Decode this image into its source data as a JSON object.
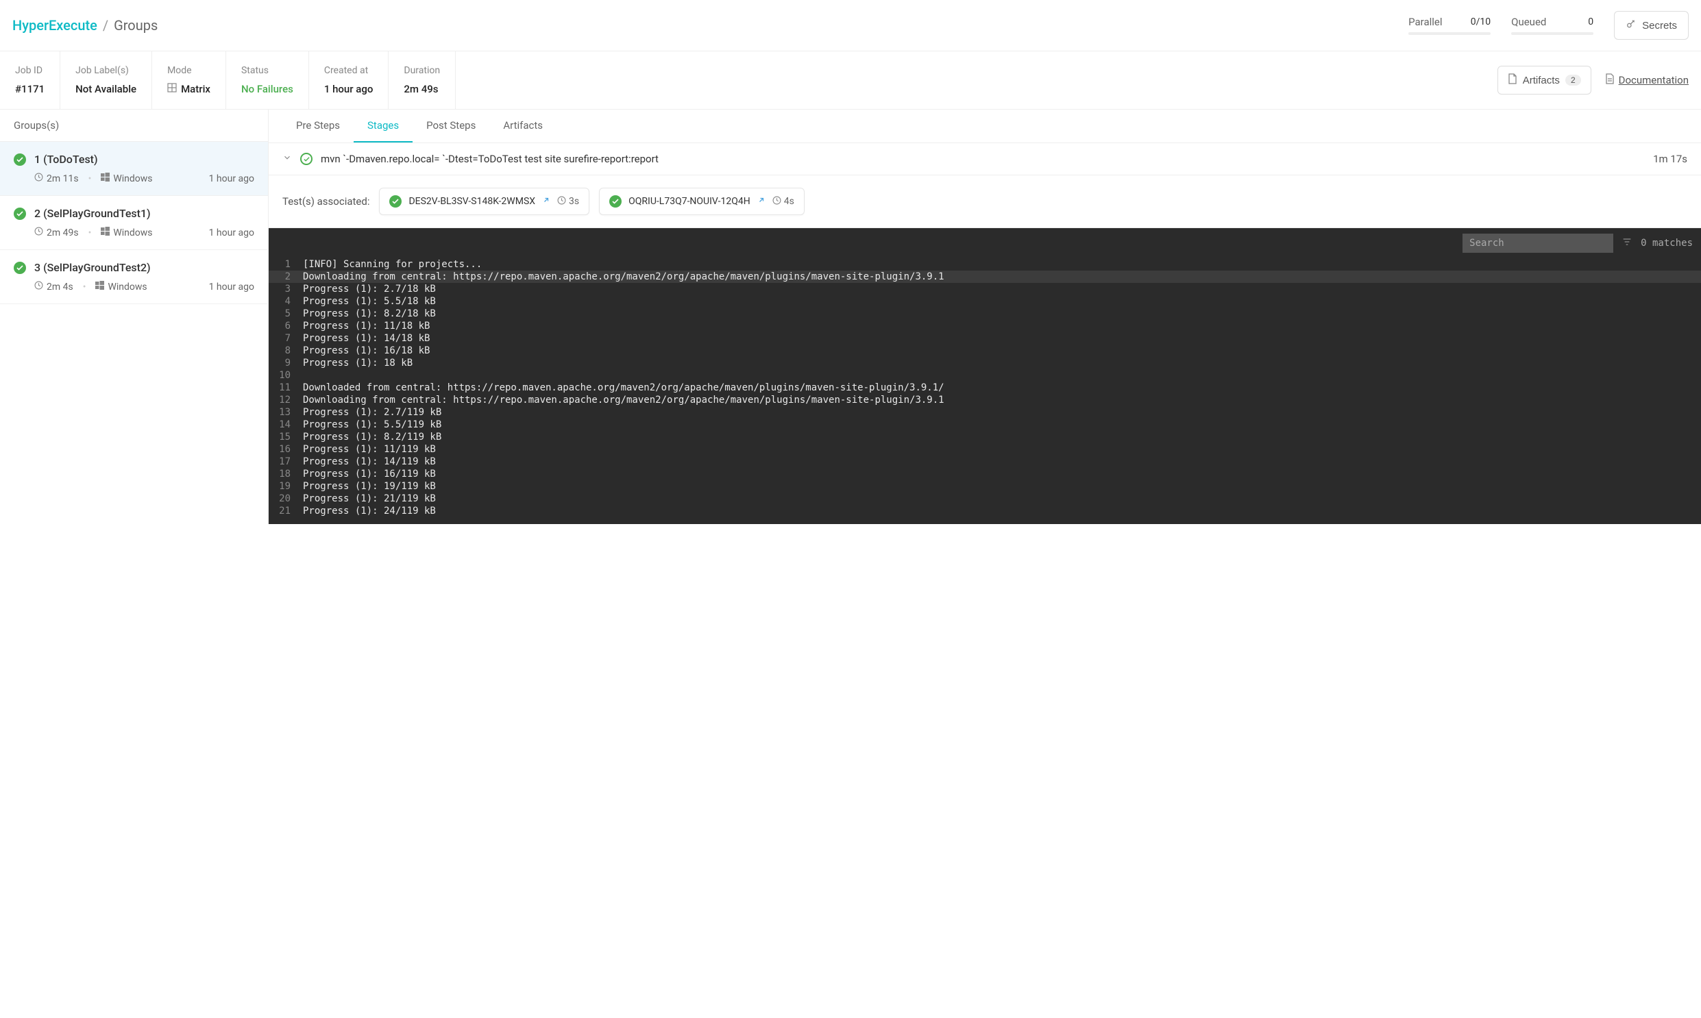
{
  "breadcrumb": {
    "root": "HyperExecute",
    "sep": "/",
    "current": "Groups"
  },
  "header_stats": {
    "parallel": {
      "label": "Parallel",
      "value": "0/10"
    },
    "queued": {
      "label": "Queued",
      "value": "0"
    }
  },
  "secrets_btn": "Secrets",
  "job_info": {
    "job_id": {
      "label": "Job ID",
      "value": "#1171"
    },
    "job_labels": {
      "label": "Job Label(s)",
      "value": "Not Available"
    },
    "mode": {
      "label": "Mode",
      "value": "Matrix"
    },
    "status": {
      "label": "Status",
      "value": "No Failures"
    },
    "created_at": {
      "label": "Created at",
      "value": "1 hour ago"
    },
    "duration": {
      "label": "Duration",
      "value": "2m 49s"
    }
  },
  "artifacts_btn": {
    "label": "Artifacts",
    "count": "2"
  },
  "documentation": "Documentation",
  "sidebar_header": "Groups(s)",
  "groups": [
    {
      "name": "1 (ToDoTest)",
      "duration": "2m 11s",
      "os": "Windows",
      "time": "1 hour ago"
    },
    {
      "name": "2 (SelPlayGroundTest1)",
      "duration": "2m 49s",
      "os": "Windows",
      "time": "1 hour ago"
    },
    {
      "name": "3 (SelPlayGroundTest2)",
      "duration": "2m 4s",
      "os": "Windows",
      "time": "1 hour ago"
    }
  ],
  "tabs": {
    "pre_steps": "Pre Steps",
    "stages": "Stages",
    "post_steps": "Post Steps",
    "artifacts": "Artifacts"
  },
  "stage": {
    "cmd": "mvn `-Dmaven.repo.local= `-Dtest=ToDoTest test site surefire-report:report",
    "duration": "1m 17s"
  },
  "tests": {
    "label": "Test(s) associated:",
    "items": [
      {
        "id": "DES2V-BL3SV-S148K-2WMSX",
        "duration": "3s"
      },
      {
        "id": "OQRIU-L73Q7-NOUIV-12Q4H",
        "duration": "4s"
      }
    ]
  },
  "console": {
    "search_placeholder": "Search",
    "matches": "0 matches",
    "lines": [
      "[INFO] Scanning for projects...",
      "Downloading from central: https://repo.maven.apache.org/maven2/org/apache/maven/plugins/maven-site-plugin/3.9.1",
      "Progress (1): 2.7/18 kB",
      "Progress (1): 5.5/18 kB",
      "Progress (1): 8.2/18 kB",
      "Progress (1): 11/18 kB",
      "Progress (1): 14/18 kB",
      "Progress (1): 16/18 kB",
      "Progress (1): 18 kB",
      "",
      "Downloaded from central: https://repo.maven.apache.org/maven2/org/apache/maven/plugins/maven-site-plugin/3.9.1/",
      "Downloading from central: https://repo.maven.apache.org/maven2/org/apache/maven/plugins/maven-site-plugin/3.9.1",
      "Progress (1): 2.7/119 kB",
      "Progress (1): 5.5/119 kB",
      "Progress (1): 8.2/119 kB",
      "Progress (1): 11/119 kB",
      "Progress (1): 14/119 kB",
      "Progress (1): 16/119 kB",
      "Progress (1): 19/119 kB",
      "Progress (1): 21/119 kB",
      "Progress (1): 24/119 kB"
    ]
  }
}
